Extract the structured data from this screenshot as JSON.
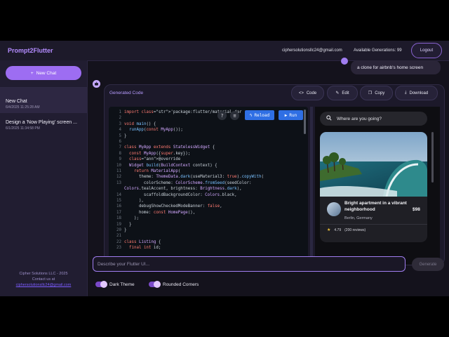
{
  "app": {
    "title": "Prompt2Flutter"
  },
  "header": {
    "email": "ciphersolutionsllc24@gmail.com",
    "generations": "Available Generations: 99",
    "logout": "Logout"
  },
  "sidebar": {
    "new_chat": "New Chat",
    "chats": [
      {
        "title": "New Chat",
        "date": "6/4/2025 11:25:28 AM"
      },
      {
        "title": "Design a 'Now Playing' screen ...",
        "date": "6/1/2025 11:34:58 PM"
      }
    ],
    "footer": {
      "company": "Cipher Solutions LLC - 2025",
      "contact": "Contact us at",
      "link": "ciphersolutionsllc24@gmail.com"
    }
  },
  "conversation": {
    "user_message": "a clone for airbnb's home screen"
  },
  "result": {
    "label": "Generated Code",
    "buttons": {
      "code": "Code",
      "edit": "Edit",
      "copy": "Copy",
      "download": "Download"
    },
    "editor": {
      "reload": "Reload",
      "run": "Run",
      "lines": [
        {
          "n": "1",
          "t": "import 'package:flutter/material.dar"
        },
        {
          "n": "2",
          "t": ""
        },
        {
          "n": "3",
          "t": "void main() {"
        },
        {
          "n": "4",
          "t": "  runApp(const MyApp());"
        },
        {
          "n": "5",
          "t": "}"
        },
        {
          "n": "6",
          "t": ""
        },
        {
          "n": "7",
          "t": "class MyApp extends StatelessWidget {"
        },
        {
          "n": "8",
          "t": "  const MyApp({super.key});"
        },
        {
          "n": "9",
          "t": "  @override"
        },
        {
          "n": "10",
          "t": "  Widget build(BuildContext context) {"
        },
        {
          "n": "11",
          "t": "    return MaterialApp("
        },
        {
          "n": "12",
          "t": "      theme: ThemeData.dark(useMaterial3: true).copyWith("
        },
        {
          "n": "13",
          "t": "        colorScheme: ColorScheme.fromSeed(seedColor:"
        },
        {
          "n": "",
          "t": "Colors.tealAccent, brightness: Brightness.dark),"
        },
        {
          "n": "14",
          "t": "        scaffoldBackgroundColor: Colors.black,"
        },
        {
          "n": "15",
          "t": "      ),"
        },
        {
          "n": "16",
          "t": "      debugShowCheckedModeBanner: false,"
        },
        {
          "n": "17",
          "t": "      home: const HomePage(),"
        },
        {
          "n": "18",
          "t": "    );"
        },
        {
          "n": "19",
          "t": "  }"
        },
        {
          "n": "20",
          "t": "}"
        },
        {
          "n": "21",
          "t": ""
        },
        {
          "n": "22",
          "t": "class Listing {"
        },
        {
          "n": "23",
          "t": "  final int id;"
        }
      ]
    },
    "preview": {
      "search_placeholder": "Where are you going?",
      "listing": {
        "title": "Bright apartment in a vibrant neighborhood",
        "price": "$98",
        "location": "Berlin, Germany",
        "rating": "4.79",
        "reviews": "(200 reviews)"
      }
    }
  },
  "composer": {
    "placeholder": "Describe your Flutter UI...",
    "generate": "Generate"
  },
  "toggles": {
    "dark_theme": "Dark Theme",
    "rounded_corners": "Rounded Corners"
  },
  "colors": {
    "accent": "#9d6df2",
    "run_blue": "#2f6fe4",
    "background": "#14121c"
  }
}
